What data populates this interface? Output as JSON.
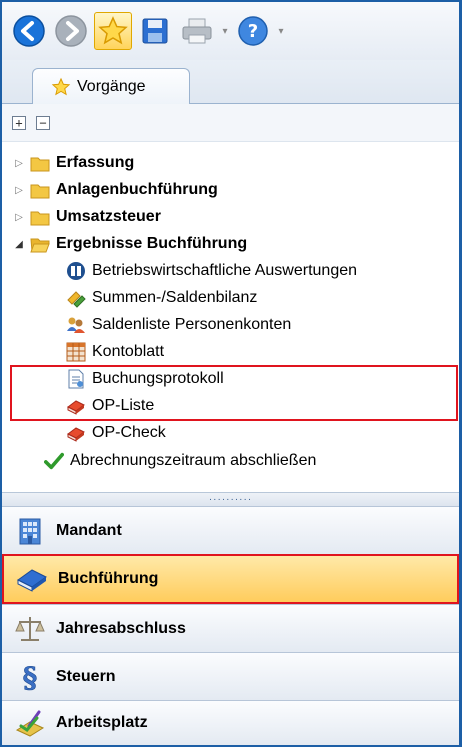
{
  "tab": {
    "label": "Vorgänge"
  },
  "tree": {
    "items": [
      {
        "label": "Erfassung"
      },
      {
        "label": "Anlagenbuchführung"
      },
      {
        "label": "Umsatzsteuer"
      },
      {
        "label": "Ergebnisse Buchführung"
      },
      {
        "label": "Betriebswirtschaftliche Auswertungen"
      },
      {
        "label": "Summen-/Saldenbilanz"
      },
      {
        "label": "Saldenliste Personenkonten"
      },
      {
        "label": "Kontoblatt"
      },
      {
        "label": "Buchungsprotokoll"
      },
      {
        "label": "OP-Liste"
      },
      {
        "label": "OP-Check"
      },
      {
        "label": "Abrechnungszeitraum abschließen"
      }
    ]
  },
  "nav": {
    "items": [
      {
        "label": "Mandant"
      },
      {
        "label": "Buchführung"
      },
      {
        "label": "Jahresabschluss"
      },
      {
        "label": "Steuern"
      },
      {
        "label": "Arbeitsplatz"
      }
    ]
  },
  "colors": {
    "highlight": "#e0141e",
    "accent": "#1d5fa6",
    "active_nav": "#ffcc5c"
  }
}
